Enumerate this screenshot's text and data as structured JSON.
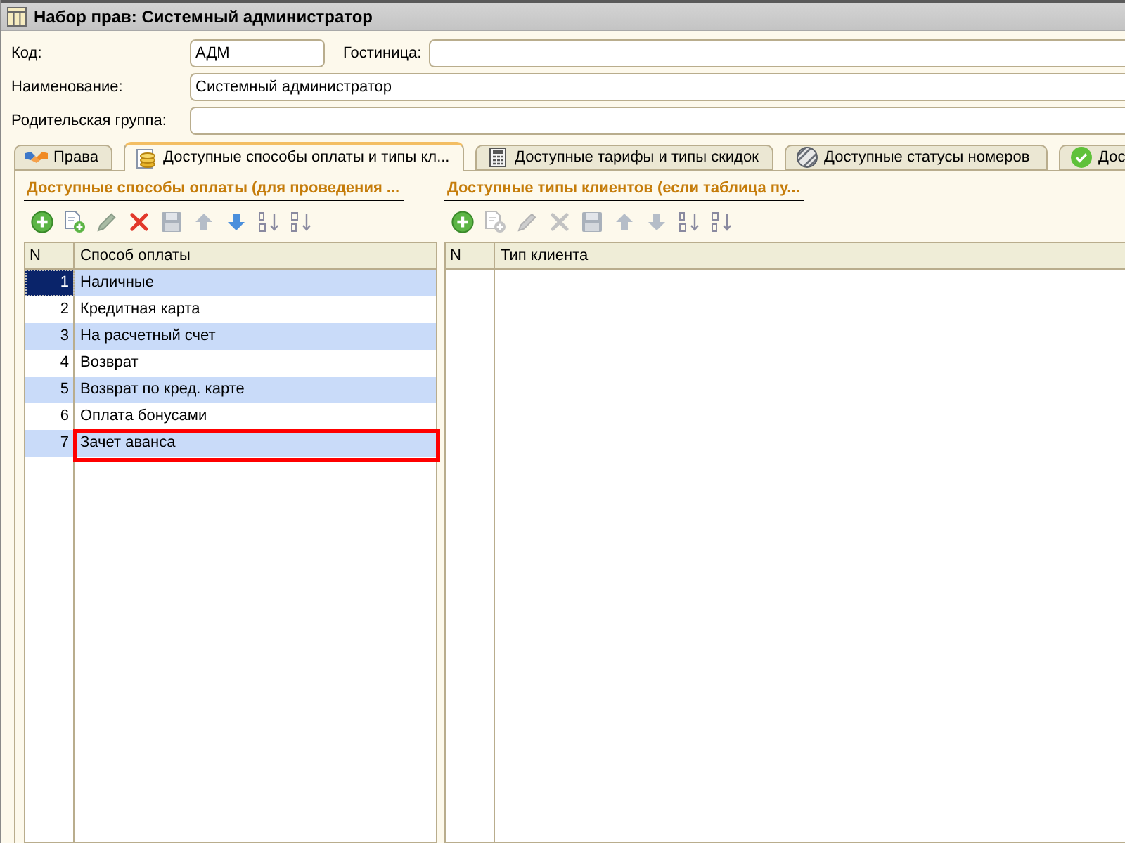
{
  "window": {
    "title": "Набор прав: Системный администратор"
  },
  "fields": {
    "code": {
      "label": "Код:",
      "value": "АДМ"
    },
    "hotel": {
      "label": "Гостиница:"
    },
    "name": {
      "label": "Наименование:",
      "value": "Системный администратор"
    },
    "parent_group": {
      "label": "Родительская группа:"
    }
  },
  "tabs": [
    {
      "label": "Права",
      "selected": false
    },
    {
      "label": "Доступные способы оплаты и типы кл...",
      "selected": true
    },
    {
      "label": "Доступные тарифы и типы скидок",
      "selected": false
    },
    {
      "label": "Доступные статусы номеров",
      "selected": false
    },
    {
      "label": "Дос",
      "selected": false
    }
  ],
  "panels": [
    {
      "title": "Доступные способы оплаты (для проведения ...",
      "toolbar": [
        {
          "kind": "add",
          "disabled": false
        },
        {
          "kind": "copy",
          "disabled": false
        },
        {
          "kind": "edit",
          "disabled": false
        },
        {
          "kind": "delete",
          "disabled": false
        },
        {
          "kind": "save",
          "disabled": true
        },
        {
          "kind": "up",
          "disabled": true
        },
        {
          "kind": "down",
          "disabled": false
        },
        {
          "kind": "sortasc",
          "disabled": false
        },
        {
          "kind": "sortdesc",
          "disabled": false
        }
      ],
      "table": {
        "columns": [
          "N",
          "Способ оплаты"
        ],
        "rows": [
          {
            "n": "1",
            "value": "Наличные",
            "selected": true,
            "highlighted": false
          },
          {
            "n": "2",
            "value": "Кредитная карта",
            "selected": false,
            "highlighted": false
          },
          {
            "n": "3",
            "value": "На расчетный счет",
            "selected": false,
            "highlighted": false
          },
          {
            "n": "4",
            "value": "Возврат",
            "selected": false,
            "highlighted": false
          },
          {
            "n": "5",
            "value": "Возврат по кред. карте",
            "selected": false,
            "highlighted": false
          },
          {
            "n": "6",
            "value": "Оплата бонусами",
            "selected": false,
            "highlighted": false
          },
          {
            "n": "7",
            "value": "Зачет аванса",
            "selected": false,
            "highlighted": true
          }
        ]
      }
    },
    {
      "title": "Доступные типы клиентов (если таблица пу...",
      "toolbar": [
        {
          "kind": "add",
          "disabled": false
        },
        {
          "kind": "copy",
          "disabled": true
        },
        {
          "kind": "edit",
          "disabled": true
        },
        {
          "kind": "delete",
          "disabled": true
        },
        {
          "kind": "save",
          "disabled": true
        },
        {
          "kind": "up",
          "disabled": true
        },
        {
          "kind": "down",
          "disabled": true
        },
        {
          "kind": "sortasc",
          "disabled": false
        },
        {
          "kind": "sortdesc",
          "disabled": false
        }
      ],
      "table": {
        "columns": [
          "N",
          "Тип клиента"
        ]
      }
    }
  ]
}
